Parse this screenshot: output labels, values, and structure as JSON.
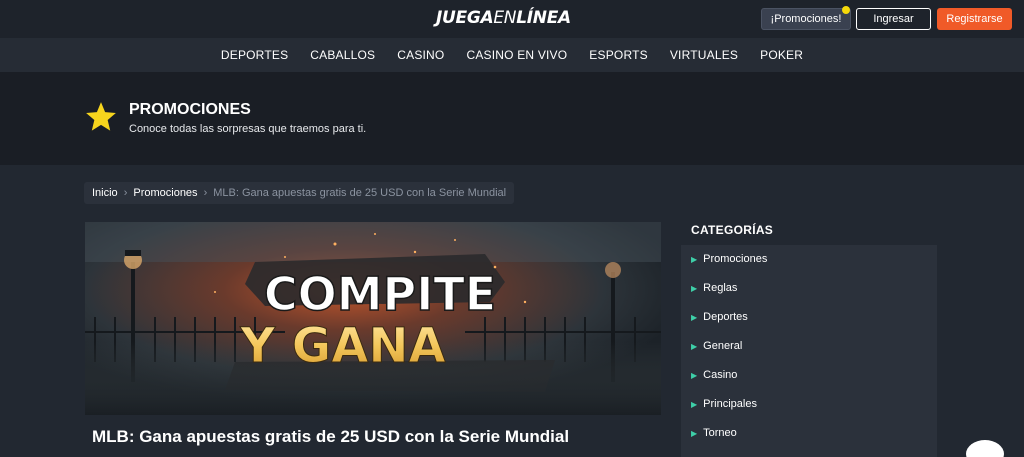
{
  "header": {
    "logo_bold": "JUEGA",
    "logo_thin": "EN",
    "logo_end": "LÍNEA",
    "promotions_button": "¡Promociones!",
    "login_button": "Ingresar",
    "register_button": "Registrarse",
    "colors": {
      "register": "#f05a28",
      "promo_dot": "#f5d90a"
    }
  },
  "nav": {
    "items": [
      "DEPORTES",
      "CABALLOS",
      "CASINO",
      "CASINO EN VIVO",
      "ESPORTS",
      "VIRTUALES",
      "POKER"
    ]
  },
  "hero": {
    "icon": "star-icon",
    "title": "PROMOCIONES",
    "subtitle": "Conoce todas las sorpresas que traemos para ti."
  },
  "breadcrumb": {
    "home": "Inicio",
    "section": "Promociones",
    "separator": "›",
    "current": "MLB: Gana apuestas gratis de 25 USD con la Serie Mundial"
  },
  "banner": {
    "line1": "COMPITE",
    "line2": "Y GANA"
  },
  "article": {
    "title": "MLB: Gana apuestas gratis de 25 USD con la Serie Mundial"
  },
  "sidebar": {
    "heading": "CATEGORÍAS",
    "items": [
      "Promociones",
      "Reglas",
      "Deportes",
      "General",
      "Casino",
      "Principales",
      "Torneo"
    ],
    "accent": "#3ecfa8"
  }
}
